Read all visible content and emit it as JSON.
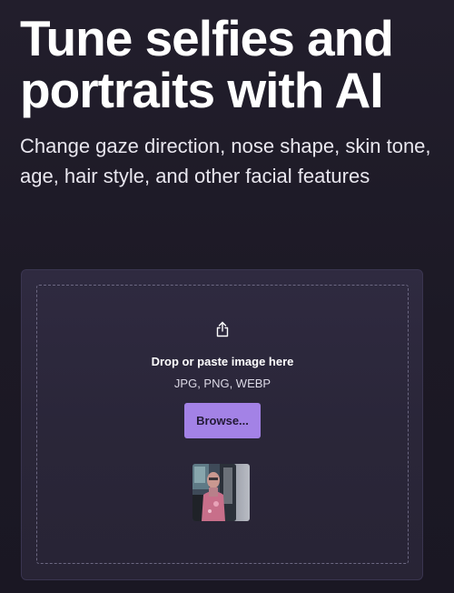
{
  "hero": {
    "headline": "Tune selfies and portraits with AI",
    "subtitle": "Change gaze direction, nose shape, skin tone, age, hair style, and other facial features"
  },
  "upload": {
    "icon": "share-upload-icon",
    "title": "Drop or paste image here",
    "formats": "JPG, PNG, WEBP",
    "browse_label": "Browse...",
    "accent_color": "#a382e6"
  },
  "colors": {
    "background": "#1c1925",
    "card": "#2c283b",
    "text": "#ffffff"
  }
}
